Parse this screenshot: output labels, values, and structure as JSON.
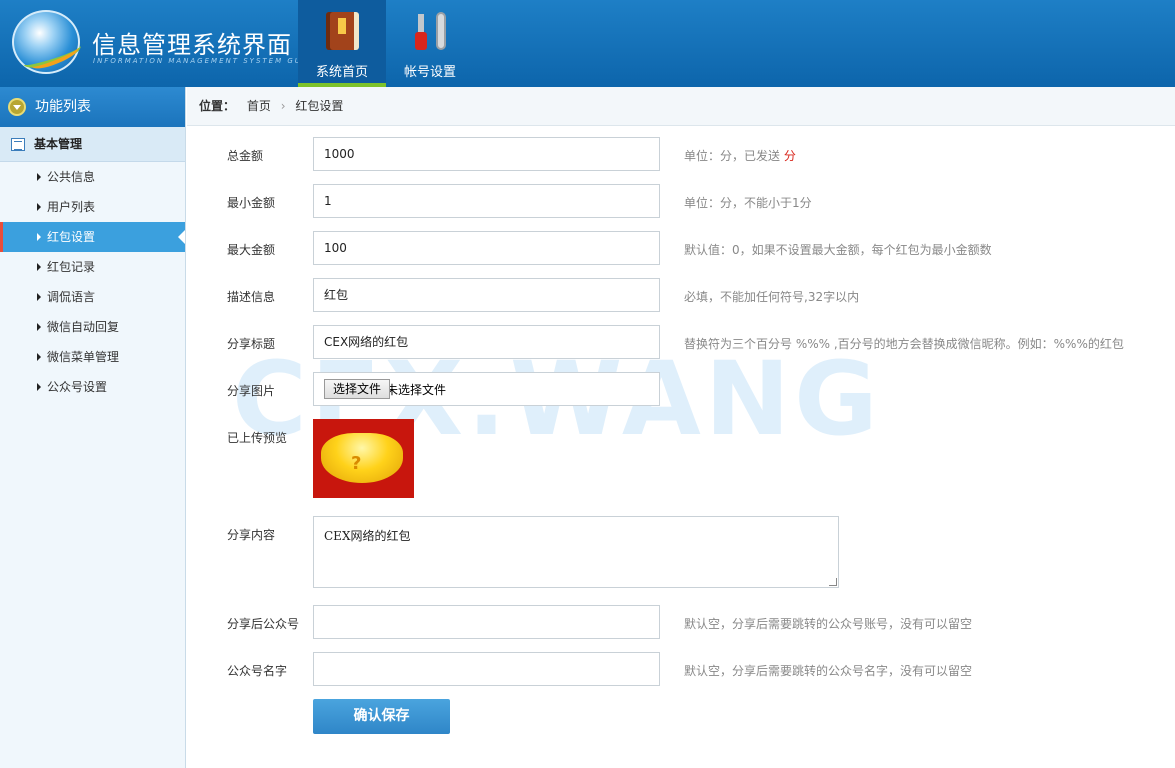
{
  "header": {
    "title": "信息管理系统界面",
    "subtitle": "INFORMATION MANAGEMENT SYSTEM GUI",
    "nav": [
      {
        "label": "系统首页",
        "icon": "book-icon",
        "active": true
      },
      {
        "label": "帐号设置",
        "icon": "tools-icon",
        "active": false
      }
    ]
  },
  "sidebar": {
    "head": "功能列表",
    "group": "基本管理",
    "items": [
      {
        "label": "公共信息"
      },
      {
        "label": "用户列表"
      },
      {
        "label": "红包设置",
        "active": true
      },
      {
        "label": "红包记录"
      },
      {
        "label": "调侃语言"
      },
      {
        "label": "微信自动回复"
      },
      {
        "label": "微信菜单管理"
      },
      {
        "label": "公众号设置"
      }
    ]
  },
  "breadcrumb": {
    "prefix": "位置：",
    "home": "首页",
    "sep": "›",
    "current": "红包设置"
  },
  "watermark": "CEX.WANG",
  "form": {
    "total": {
      "label": "总金额",
      "value": "1000",
      "hint": "单位：分，已发送 ",
      "hint_red": "分"
    },
    "max1": {
      "label": "最小金额",
      "value": "1",
      "hint": "单位：分，不能小于1分"
    },
    "max2": {
      "label": "最大金额",
      "value": "100",
      "hint": "默认值：0，如果不设置最大金额，每个红包为最小金额数"
    },
    "desc": {
      "label": "描述信息",
      "value": "红包",
      "hint": "必填，不能加任何符号,32字以内"
    },
    "share_title": {
      "label": "分享标题",
      "value": "CEX网络的红包",
      "hint": "替换符为三个百分号 %%% ,百分号的地方会替换成微信昵称。例如：%%%的红包"
    },
    "share_image": {
      "label": "分享图片",
      "button": "选择文件",
      "text": "未选择文件"
    },
    "preview": {
      "label": "已上传预览",
      "glyph": "?"
    },
    "share_content": {
      "label": "分享内容",
      "value": "CEX网络的红包"
    },
    "share_account": {
      "label": "分享后公众号",
      "value": "",
      "hint": "默认空，分享后需要跳转的公众号账号，没有可以留空"
    },
    "account_name": {
      "label": "公众号名字",
      "value": "",
      "hint": "默认空，分享后需要跳转的公众号名字，没有可以留空"
    },
    "save": "确认保存"
  }
}
